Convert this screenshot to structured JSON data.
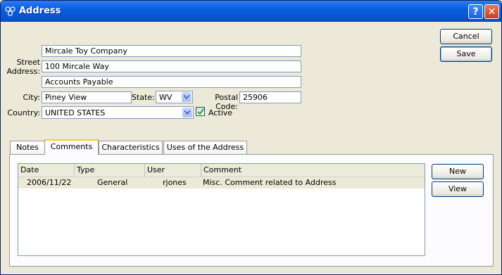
{
  "window": {
    "title": "Address",
    "help_label": "?",
    "close_label": "✕"
  },
  "form": {
    "street_label": "Street\nAddress:",
    "street_lines": [
      "Mircale Toy Company",
      "100 Mircale Way",
      "Accounts Payable"
    ],
    "city_label": "City:",
    "city": "Piney View",
    "state_label": "State:",
    "state": "WV",
    "postal_label": "Postal Code:",
    "postal": "25906",
    "country_label": "Country:",
    "country": "UNITED STATES",
    "active_label": "Active",
    "active_checked": true
  },
  "buttons": {
    "cancel": "Cancel",
    "save": "Save",
    "new": "New",
    "view": "View"
  },
  "tabs": [
    "Notes",
    "Comments",
    "Characteristics",
    "Uses of the Address"
  ],
  "active_tab": "Comments",
  "comments": {
    "columns": [
      "Date",
      "Type",
      "User",
      "Comment"
    ],
    "rows": [
      {
        "date": "2006/11/22",
        "type": "General",
        "user": "rjones",
        "comment": "Misc. Comment related to Address"
      }
    ]
  },
  "colors": {
    "titlebar": "#0a54d2",
    "window_bg": "#ece9d8",
    "active_tab_accent": "#ffc83c",
    "checkbox_check": "#21a121"
  }
}
